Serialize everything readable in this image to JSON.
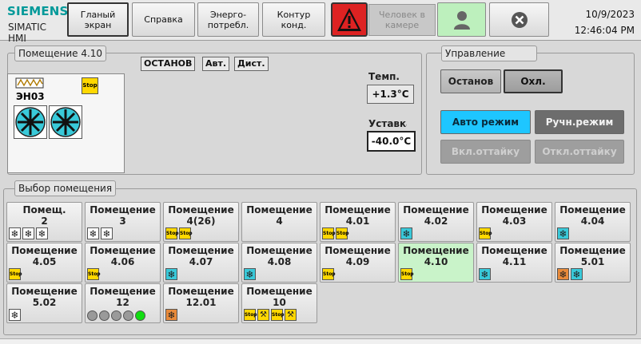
{
  "header": {
    "brand": "SIEMENS",
    "subtitle": "SIMATIC HMI",
    "nav": [
      {
        "label": "Гланый\nэкран",
        "active": true
      },
      {
        "label": "Справка",
        "active": false
      },
      {
        "label": "Энерго-\nпотребл.",
        "active": false
      },
      {
        "label": "Контур\nконд.",
        "active": false
      }
    ],
    "person_label": "Человек в\nкамере",
    "date": "10/9/2023",
    "time": "12:46:04 PM"
  },
  "room": {
    "title": "Помещение 4.10",
    "states": [
      "ОСТАНОВ",
      "Авт.",
      "Дист."
    ],
    "heater_label": "ЭН03",
    "temp_label": "Темп.",
    "temp_value": "+1.3°C",
    "setpoint_label": "Уставка",
    "setpoint_value": "-40.0°C"
  },
  "control": {
    "title": "Управление",
    "stop": "Останов",
    "cool": "Охл.",
    "auto": "Авто режим",
    "manual": "Ручн.режим",
    "defrost_on": "Вкл.оттайку",
    "defrost_off": "Откл.оттайку"
  },
  "selection": {
    "title": "Выбор помещения",
    "tiles": [
      {
        "l1": "Помещ.",
        "l2": "2",
        "icons": [
          "fan",
          "fan",
          "fan"
        ]
      },
      {
        "l1": "Помещение",
        "l2": "3",
        "icons": [
          "fan",
          "fan"
        ]
      },
      {
        "l1": "Помещение",
        "l2": "4(26)",
        "icons": [
          "stop",
          "stop"
        ]
      },
      {
        "l1": "Помещение",
        "l2": "4",
        "icons": []
      },
      {
        "l1": "Помещение",
        "l2": "4.01",
        "icons": [
          "stop",
          "stop"
        ]
      },
      {
        "l1": "Помещение",
        "l2": "4.02",
        "icons": [
          "fan-cyan"
        ]
      },
      {
        "l1": "Помещение",
        "l2": "4.03",
        "icons": [
          "stop"
        ]
      },
      {
        "l1": "Помещение",
        "l2": "4.04",
        "icons": [
          "fan-cyan"
        ]
      },
      {
        "l1": "Помещение",
        "l2": "4.05",
        "icons": [
          "stop"
        ]
      },
      {
        "l1": "Помещение",
        "l2": "4.06",
        "icons": [
          "stop"
        ]
      },
      {
        "l1": "Помещение",
        "l2": "4.07",
        "icons": [
          "fan-cyan"
        ]
      },
      {
        "l1": "Помещение",
        "l2": "4.08",
        "icons": [
          "fan-cyan"
        ]
      },
      {
        "l1": "Помещение",
        "l2": "4.09",
        "icons": [
          "stop"
        ]
      },
      {
        "l1": "Помещение",
        "l2": "4.10",
        "icons": [
          "stop"
        ],
        "selected": true
      },
      {
        "l1": "Помещение",
        "l2": "4.11",
        "icons": [
          "fan-cyan"
        ]
      },
      {
        "l1": "Помещение",
        "l2": "5.01",
        "icons": [
          "fan-orange",
          "fan-cyan"
        ]
      },
      {
        "l1": "Помещение",
        "l2": "5.02",
        "icons": [
          "fan"
        ]
      },
      {
        "l1": "Помещение",
        "l2": "12",
        "icons": [
          "dot",
          "dot",
          "dot",
          "dot",
          "dot-on"
        ]
      },
      {
        "l1": "Помещение",
        "l2": "12.01",
        "icons": [
          "fan-orange"
        ]
      },
      {
        "l1": "Помещение",
        "l2": "10",
        "icons": [
          "stop",
          "tool",
          "stop",
          "tool"
        ]
      }
    ]
  }
}
